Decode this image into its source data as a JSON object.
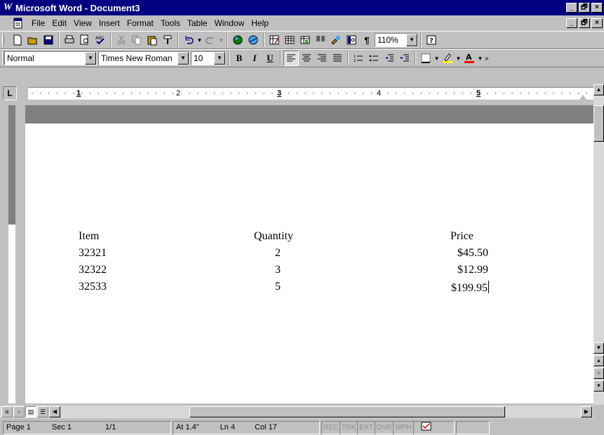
{
  "window": {
    "title": "Microsoft Word - Document3",
    "minimize": "_",
    "restore": "🗗",
    "close": "×"
  },
  "menubar": {
    "items": [
      "File",
      "Edit",
      "View",
      "Insert",
      "Format",
      "Tools",
      "Table",
      "Window",
      "Help"
    ]
  },
  "standard_toolbar": {
    "zoom": "110%"
  },
  "formatting_toolbar": {
    "style": "Normal",
    "font": "Times New Roman",
    "size": "10",
    "bold": "B",
    "italic": "I",
    "underline": "U"
  },
  "ruler": {
    "numbers": [
      "1",
      "2",
      "3",
      "4",
      "5"
    ]
  },
  "document": {
    "headers": [
      "Item",
      "Quantity",
      "Price"
    ],
    "rows": [
      [
        "32321",
        "2",
        "$45.50"
      ],
      [
        "32322",
        "3",
        "$12.99"
      ],
      [
        "32533",
        "5",
        "$199.95"
      ]
    ]
  },
  "statusbar": {
    "page": "Page 1",
    "section": "Sec 1",
    "pages": "1/1",
    "at": "At 1.4\"",
    "line": "Ln 4",
    "col": "Col 17",
    "indicators": [
      "REC",
      "TRK",
      "EXT",
      "OVR",
      "WPH"
    ]
  },
  "colors": {
    "titlebar": "#000080",
    "chrome": "#c0c0c0",
    "shadow": "#808080",
    "paper": "#ffffff"
  },
  "icons": [
    "new-icon",
    "open-icon",
    "save-icon",
    "print-icon",
    "print-preview-icon",
    "spelling-icon",
    "cut-icon",
    "copy-icon",
    "paste-icon",
    "format-painter-icon",
    "undo-icon",
    "redo-icon",
    "web-toolbar-icon",
    "hyperlink-icon",
    "tables-borders-icon",
    "insert-table-icon",
    "insert-excel-icon",
    "columns-icon",
    "drawing-icon",
    "document-map-icon",
    "show-hide-icon",
    "help-icon",
    "align-left-icon",
    "center-icon",
    "align-right-icon",
    "justify-icon",
    "numbering-icon",
    "bullets-icon",
    "decrease-indent-icon",
    "increase-indent-icon",
    "borders-icon",
    "highlight-icon",
    "font-color-icon"
  ]
}
